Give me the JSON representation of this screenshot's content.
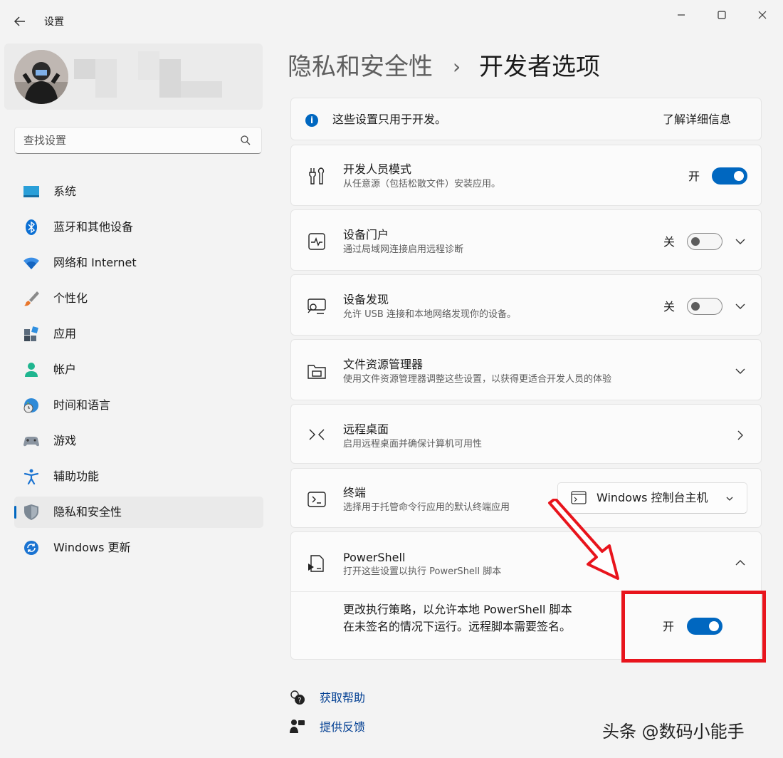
{
  "window": {
    "title": "设置",
    "back_icon": "back-arrow-icon",
    "controls": [
      "minimize-icon",
      "maximize-icon",
      "close-icon"
    ]
  },
  "search": {
    "placeholder": "查找设置"
  },
  "sidebar": {
    "items": [
      {
        "label": "系统",
        "icon": "system-display-icon"
      },
      {
        "label": "蓝牙和其他设备",
        "icon": "bluetooth-icon"
      },
      {
        "label": "网络和 Internet",
        "icon": "wifi-icon"
      },
      {
        "label": "个性化",
        "icon": "paintbrush-icon"
      },
      {
        "label": "应用",
        "icon": "apps-icon"
      },
      {
        "label": "帐户",
        "icon": "account-icon"
      },
      {
        "label": "时间和语言",
        "icon": "globe-clock-icon"
      },
      {
        "label": "游戏",
        "icon": "gamepad-icon"
      },
      {
        "label": "辅助功能",
        "icon": "accessibility-icon"
      },
      {
        "label": "隐私和安全性",
        "icon": "shield-icon",
        "active": true
      },
      {
        "label": "Windows 更新",
        "icon": "windows-update-icon"
      }
    ]
  },
  "header": {
    "parent": "隐私和安全性",
    "separator": "›",
    "current": "开发者选项"
  },
  "info_bar": {
    "text": "这些设置只用于开发。",
    "link": "了解详细信息"
  },
  "settings": {
    "developer_mode": {
      "title": "开发人员模式",
      "subtitle": "从任意源（包括松散文件）安装应用。",
      "state": "开",
      "on": true
    },
    "device_portal": {
      "title": "设备门户",
      "subtitle": "通过局域网连接启用远程诊断",
      "state": "关",
      "on": false
    },
    "device_discovery": {
      "title": "设备发现",
      "subtitle": "允许 USB 连接和本地网络发现你的设备。",
      "state": "关",
      "on": false
    },
    "file_explorer": {
      "title": "文件资源管理器",
      "subtitle": "使用文件资源管理器调整这些设置，以获得更适合开发人员的体验"
    },
    "remote_desktop": {
      "title": "远程桌面",
      "subtitle": "启用远程桌面并确保计算机可用性"
    },
    "terminal": {
      "title": "终端",
      "subtitle": "选择用于托管命令行应用的默认终端应用",
      "selected": "Windows 控制台主机"
    },
    "powershell": {
      "title": "PowerShell",
      "subtitle": "打开这些设置以执行 PowerShell 脚本",
      "policy_text": "更改执行策略，以允许本地 PowerShell 脚本在未签名的情况下运行。远程脚本需要签名。",
      "policy_state": "开",
      "policy_on": true
    }
  },
  "footer": {
    "help": "获取帮助",
    "feedback": "提供反馈"
  },
  "watermark": "头条 @数码小能手",
  "colors": {
    "accent": "#0067c0",
    "highlight": "#e8141c"
  }
}
